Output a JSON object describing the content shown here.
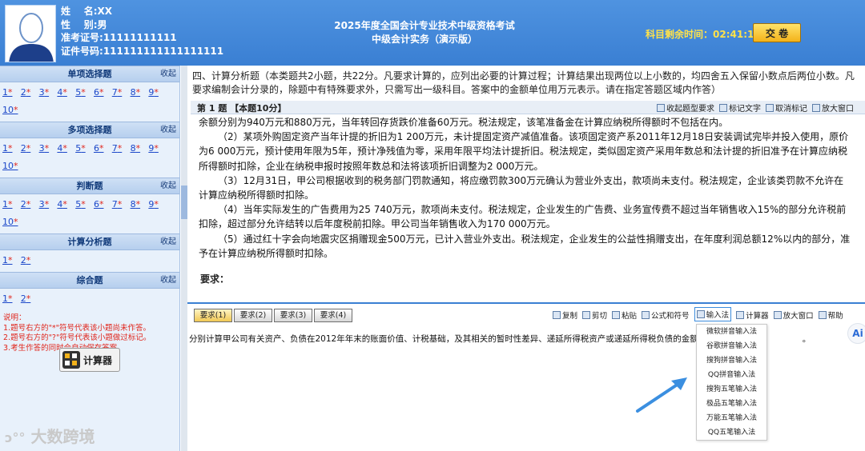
{
  "candidate": {
    "name_label": "姓    名:",
    "name_value": "XX",
    "gender_label": "性    别:",
    "gender_value": "男",
    "ticket_label": "准考证号:",
    "ticket_value": "11111111111",
    "id_label": "证件号码:",
    "id_value": "111111111111111111"
  },
  "header": {
    "title_line1": "2025年度全国会计专业技术中级资格考试",
    "title_line2": "中级会计实务（演示版）",
    "timer_label": "科目剩余时间：",
    "timer_value": "02:41:15",
    "submit_label": "交 卷"
  },
  "sidebar": {
    "collapse_label": "收起",
    "sections": [
      {
        "title": "单项选择题",
        "questions": [
          "1",
          "2",
          "3",
          "4",
          "5",
          "6",
          "7",
          "8",
          "9",
          "10"
        ]
      },
      {
        "title": "多项选择题",
        "questions": [
          "1",
          "2",
          "3",
          "4",
          "5",
          "6",
          "7",
          "8",
          "9",
          "10"
        ]
      },
      {
        "title": "判断题",
        "questions": [
          "1",
          "2",
          "3",
          "4",
          "5",
          "6",
          "7",
          "8",
          "9",
          "10"
        ]
      },
      {
        "title": "计算分析题",
        "questions": [
          "1",
          "2"
        ]
      },
      {
        "title": "综合题",
        "questions": [
          "1",
          "2"
        ]
      }
    ],
    "star_mark": "*",
    "notes": [
      "说明：",
      "1.题号右方的\"*\"符号代表该小题尚未作答。",
      "2.题号右方的\"?\"符号代表该小题做过标记。",
      "3.考生作答的同时会自动保存答案。"
    ],
    "calculator_label": "计算器",
    "watermark": "大数跨境"
  },
  "main": {
    "section_intro": "四、计算分析题（本类题共2小题，共22分。凡要求计算的，应列出必要的计算过程；计算结果出现两位以上小数的，均四舍五入保留小数点后两位小数。凡要求编制会计分录的，除题中有特殊要求外，只需写出一级科目。答案中的金额单位用万元表示。请在指定答题区域内作答）",
    "question_label": "第 1 题 【本题10分】",
    "tools": [
      "收起题型要求",
      "标记文字",
      "取消标记",
      "放大窗口"
    ],
    "paragraphs": [
      "余额分别为940万元和880万元，当年转回存货跌价准备60万元。税法规定，该笔准备金在计算应纳税所得额时不包括在内。",
      "（2）某项外购固定资产当年计提的折旧为1 200万元，未计提固定资产减值准备。该项固定资产系2011年12月18日安装调试完毕并投入使用，原价为6 000万元，预计使用年限为5年，预计净残值为零，采用年限平均法计提折旧。税法规定，类似固定资产采用年数总和法计提的折旧准予在计算应纳税所得额时扣除，企业在纳税申报时按照年数总和法将该项折旧调整为2 000万元。",
      "（3）12月31日，甲公司根据收到的税务部门罚款通知，将应缴罚款300万元确认为营业外支出，款项尚未支付。税法规定，企业该类罚款不允许在计算应纳税所得额时扣除。",
      "（4）当年实际发生的广告费用为25 740万元，款项尚未支付。税法规定，企业发生的广告费、业务宣传费不超过当年销售收入15%的部分允许税前扣除，超过部分允许结转以后年度税前扣除。甲公司当年销售收入为170 000万元。",
      "（5）通过红十字会向地震灾区捐赠现金500万元，已计入营业外支出。税法规定，企业发生的公益性捐赠支出，在年度利润总额12%以内的部分，准予在计算应纳税所得额时扣除。"
    ],
    "requirement_label": "要求：",
    "answer_tabs": [
      "要求(1)",
      "要求(2)",
      "要求(3)",
      "要求(4)"
    ],
    "answer_tools": [
      "复制",
      "剪切",
      "粘贴",
      "公式和符号",
      "输入法",
      "计算器",
      "放大窗口",
      "帮助"
    ],
    "answer_text": "分别计算甲公司有关资产、负债在2012年年末的账面价值、计税基础，及其相关的暂时性差异、递延所得税资产或递延所得税负债的金额",
    "answer_text_tail": "。",
    "ime_options": [
      "微软拼音输入法",
      "谷歌拼音输入法",
      "搜狗拼音输入法",
      "QQ拼音输入法",
      "搜狗五笔输入法",
      "极品五笔输入法",
      "万能五笔输入法",
      "QQ五笔输入法"
    ],
    "ai_label": "Ai"
  }
}
